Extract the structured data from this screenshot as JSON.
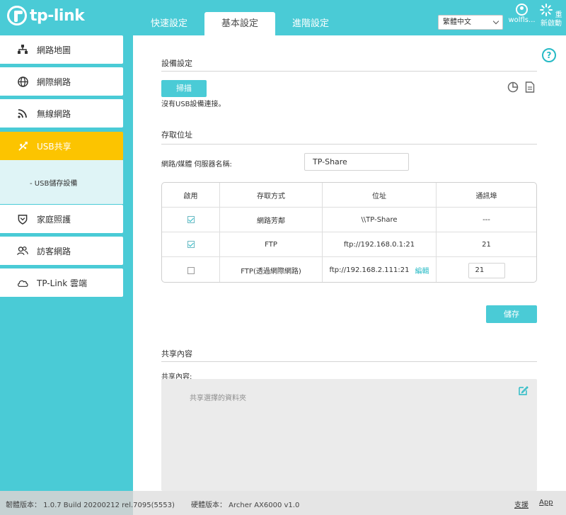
{
  "header": {
    "logo_text": "tp-link",
    "tabs": [
      {
        "label": "快速設定",
        "active": false
      },
      {
        "label": "基本設定",
        "active": true
      },
      {
        "label": "進階設定",
        "active": false
      }
    ],
    "language": "繁體中文",
    "user_label": "wolfls...",
    "reboot_label": "重新啟動",
    "accent_color": "#4acbd6"
  },
  "sidebar": {
    "items": [
      {
        "label": "網路地圖",
        "icon": "network-map-icon",
        "active": false
      },
      {
        "label": "網際網路",
        "icon": "globe-icon",
        "active": false
      },
      {
        "label": "無線網路",
        "icon": "wireless-icon",
        "active": false
      },
      {
        "label": "USB共享",
        "icon": "usb-icon",
        "active": true
      },
      {
        "label": "家庭照護",
        "icon": "shield-icon",
        "active": false
      },
      {
        "label": "訪客網路",
        "icon": "guest-icon",
        "active": false
      },
      {
        "label": "TP-Link 雲端",
        "icon": "cloud-icon",
        "active": false
      }
    ],
    "sub_item": "- USB儲存設備",
    "active_color": "#fcc400"
  },
  "main": {
    "device_section": {
      "title": "設備設定",
      "scan_button": "掃描",
      "status_text": "沒有USB設備連接。"
    },
    "access_section": {
      "title": "存取位址",
      "server_name_label": "網路/媒體 伺服器名稱:",
      "server_name_value": "TP-Share",
      "table": {
        "headers": [
          "啟用",
          "存取方式",
          "位址",
          "通訊埠"
        ],
        "rows": [
          {
            "enabled": true,
            "method": "網路芳鄰",
            "address": "\\\\TP-Share",
            "port": "---",
            "editable": false
          },
          {
            "enabled": true,
            "method": "FTP",
            "address": "ftp://192.168.0.1:21",
            "port": "21",
            "editable": false
          },
          {
            "enabled": false,
            "method": "FTP(透過網際網路)",
            "address": "ftp://192.168.2.111:21",
            "edit_label": "編輯",
            "port": "21",
            "editable": true
          }
        ]
      },
      "save_button": "儲存"
    },
    "share_section": {
      "title": "共享內容",
      "content_label": "共享內容:",
      "placeholder": "共享選擇的資料夾"
    }
  },
  "footer": {
    "firmware": "韌體版本： 1.0.7 Build 20200212 rel.7095(5553)",
    "hardware": "硬體版本： Archer AX6000 v1.0",
    "support_link": "支援",
    "app_link": "App"
  }
}
